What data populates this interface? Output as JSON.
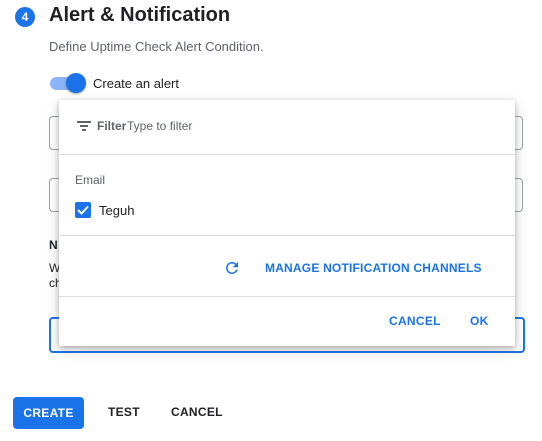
{
  "section": {
    "step_number": "4",
    "title": "Alert & Notification",
    "description": "Define Uptime Check Alert Condition."
  },
  "alert_toggle": {
    "label": "Create an alert",
    "enabled": true
  },
  "background_form": {
    "heading_fragment": "N",
    "line1_fragment": "W",
    "line2_fragment": "ch"
  },
  "dropdown": {
    "filter_label": "Filter",
    "filter_placeholder": "Type to filter",
    "group_label": "Email",
    "options": [
      {
        "label": "Teguh",
        "checked": true
      }
    ],
    "manage_label": "MANAGE NOTIFICATION CHANNELS",
    "cancel_label": "CANCEL",
    "ok_label": "OK"
  },
  "actions": {
    "create_label": "CREATE",
    "test_label": "TEST",
    "cancel_label": "CANCEL"
  },
  "colors": {
    "accent": "#1a73e8",
    "toggle_track": "#8ab4f8",
    "secondary_text": "#5f6368",
    "divider": "#dadce0"
  },
  "icons": {
    "filter": "filter-icon",
    "refresh": "refresh-icon",
    "checkbox": "checkbox-checked-icon"
  }
}
